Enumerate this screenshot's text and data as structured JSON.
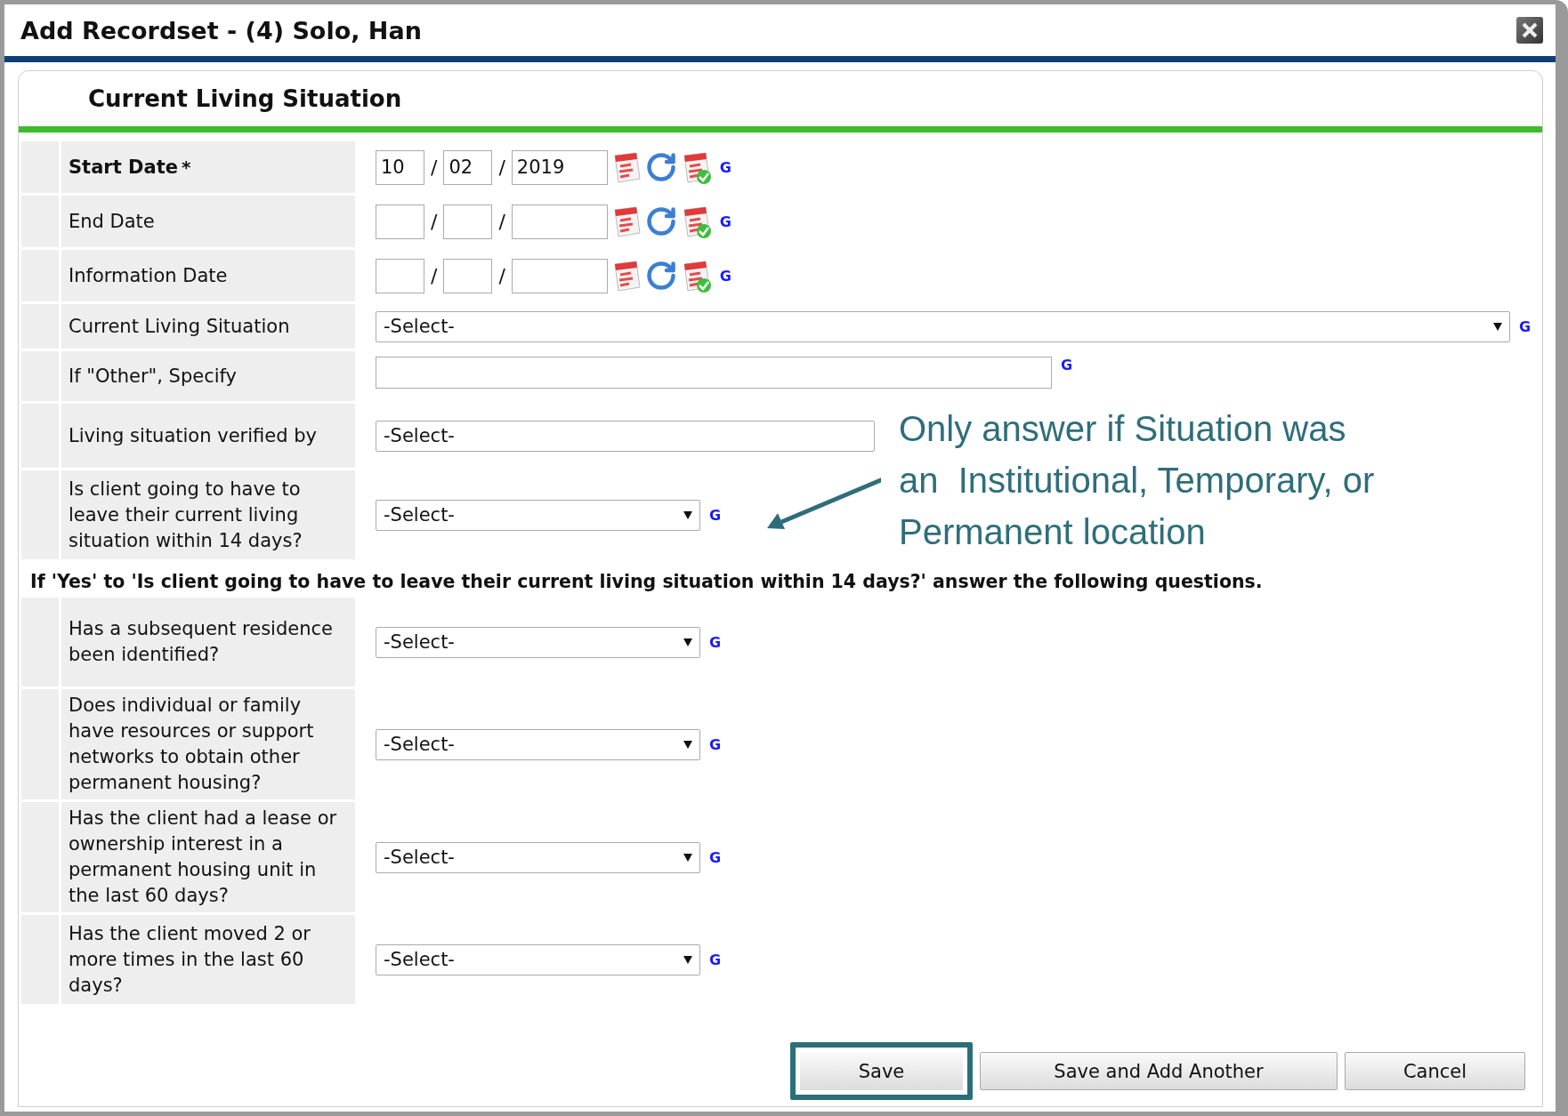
{
  "window": {
    "title": "Add Recordset - (4) Solo, Han"
  },
  "section": {
    "title": "Current Living Situation"
  },
  "fields": [
    {
      "kind": "date",
      "label": "Start Date",
      "required_mark": "*",
      "month": "10",
      "day": "02",
      "year": "2019",
      "separators": [
        "/",
        "/"
      ],
      "help": "G"
    },
    {
      "kind": "date",
      "label": "End Date",
      "separators": [
        "/",
        "/"
      ],
      "help": "G"
    },
    {
      "kind": "date",
      "label": "Information Date",
      "separators": [
        "/",
        "/"
      ],
      "help": "G"
    },
    {
      "kind": "select-wide",
      "label": "Current Living Situation",
      "value": "-Select-",
      "help": "G"
    },
    {
      "kind": "text",
      "label": "If \"Other\", Specify",
      "help": "G"
    },
    {
      "kind": "select-medium",
      "label": "Living situation verified by",
      "value": "-Select-"
    },
    {
      "kind": "select",
      "label": "Is client going to have to leave their current living situation within 14 days?",
      "value": "-Select-",
      "help": "G"
    }
  ],
  "conditional_note": "If 'Yes' to 'Is client going to have to leave their current living situation within 14 days?' answer the following questions.",
  "follow_up_fields": [
    {
      "kind": "select",
      "label": "Has a subsequent residence been identified?",
      "value": "-Select-",
      "help": "G"
    },
    {
      "kind": "select",
      "label": "Does individual or family have resources or support networks to obtain other permanent housing?",
      "value": "-Select-",
      "help": "G"
    },
    {
      "kind": "select",
      "label": "Has the client had a lease or ownership interest in a permanent housing unit in the last 60 days?",
      "value": "-Select-",
      "help": "G"
    },
    {
      "kind": "select",
      "label": "Has the client moved 2 or more times in the last 60 days?",
      "value": "-Select-",
      "help": "G"
    }
  ],
  "buttons": [
    {
      "label": "Save",
      "highlighted": true
    },
    {
      "label": "Save and Add Another",
      "highlighted": false
    },
    {
      "label": "Cancel",
      "highlighted": false
    }
  ],
  "annotation": {
    "lines": [
      "Only answer if Situation was",
      "an  Institutional, Temporary, or",
      "Permanent location"
    ]
  }
}
